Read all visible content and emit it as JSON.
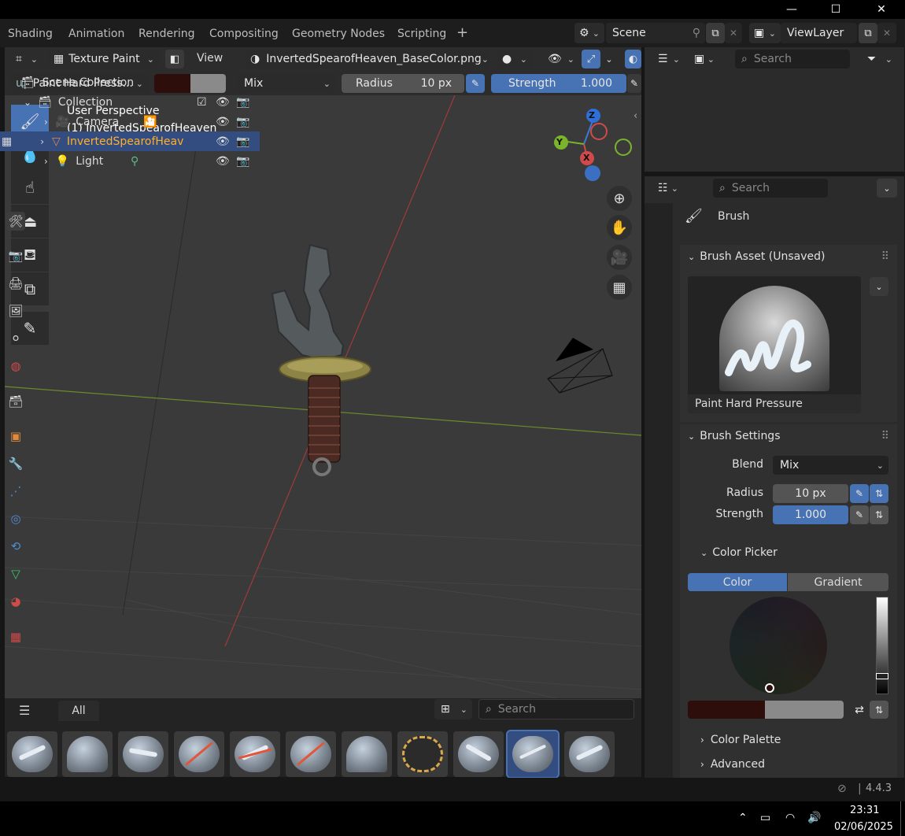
{
  "workspace_tabs": [
    "Shading",
    "Animation",
    "Rendering",
    "Compositing",
    "Geometry Nodes",
    "Scripting"
  ],
  "add_tab": "+",
  "scene": {
    "name": "Scene"
  },
  "view_layer": {
    "name": "ViewLayer"
  },
  "viewport_header": {
    "mode": "Texture Paint",
    "view_menu": "View",
    "image_name": "InvertedSpearofHeaven_BaseColor.png"
  },
  "tool_settings": {
    "brush_name": "Paint Hard Press...",
    "primary_color": "#2e0e0b",
    "secondary_color": "#8a8a8a",
    "blend": "Mix",
    "radius_label": "Radius",
    "radius_value": "10 px",
    "strength_label": "Strength",
    "strength_value": "1.000"
  },
  "viewport": {
    "perspective": "User Perspective",
    "object_label": "(1) InvertedSpearofHeaven",
    "gizmo_axes": [
      "Z",
      "Y",
      "X"
    ]
  },
  "asset_shelf": {
    "tab_all": "All",
    "search_placeholder": "Search"
  },
  "outliner": {
    "search_placeholder": "Search",
    "scene_collection": "Scene Collection",
    "collection": "Collection",
    "items": [
      "Camera",
      "InvertedSpearofHeav",
      "Light"
    ]
  },
  "properties": {
    "search_placeholder": "Search",
    "context": "Brush",
    "brush_asset_header": "Brush Asset (Unsaved)",
    "brush_asset_name": "Paint Hard Pressure",
    "brush_settings_header": "Brush Settings",
    "blend_label": "Blend",
    "blend_value": "Mix",
    "radius_label": "Radius",
    "radius_value": "10 px",
    "strength_label": "Strength",
    "strength_value": "1.000",
    "color_picker_header": "Color Picker",
    "color_tab": "Color",
    "gradient_tab": "Gradient",
    "color_palette": "Color Palette",
    "advanced": "Advanced"
  },
  "status": {
    "version": "4.4.3"
  },
  "taskbar": {
    "time": "23:31",
    "date": "02/06/2025"
  },
  "colors": {
    "accent": "#4772b3",
    "selected_row": "#334d80",
    "active_text": "#ffaf29"
  }
}
